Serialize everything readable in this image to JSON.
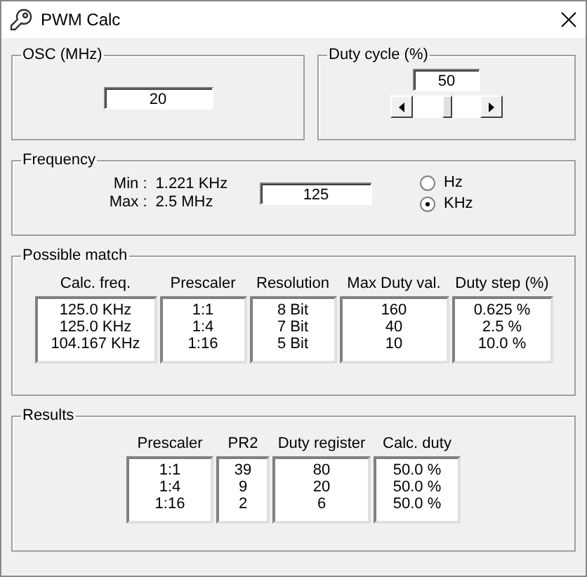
{
  "window": {
    "title": "PWM Calc"
  },
  "osc": {
    "label": "OSC (MHz)",
    "value": "20"
  },
  "duty_cycle": {
    "label": "Duty cycle (%)",
    "value": "50",
    "slider": {
      "level": 0.5
    }
  },
  "frequency": {
    "label": "Frequency",
    "min_label": "Min :",
    "min_value": "1.221 KHz",
    "max_label": "Max :",
    "max_value": "2.5 MHz",
    "value": "125",
    "units": [
      {
        "label": "Hz",
        "selected": false
      },
      {
        "label": "KHz",
        "selected": true
      }
    ]
  },
  "possible_match": {
    "label": "Possible match",
    "columns": [
      {
        "header": "Calc. freq.",
        "cells": [
          "125.0 KHz",
          "125.0 KHz",
          "104.167 KHz"
        ]
      },
      {
        "header": "Prescaler",
        "cells": [
          "1:1",
          "1:4",
          "1:16"
        ]
      },
      {
        "header": "Resolution",
        "cells": [
          "8 Bit",
          "7 Bit",
          "5 Bit"
        ]
      },
      {
        "header": "Max Duty val.",
        "cells": [
          "160",
          "40",
          "10"
        ]
      },
      {
        "header": "Duty step (%)",
        "cells": [
          "0.625 %",
          "2.5 %",
          "10.0 %"
        ]
      }
    ]
  },
  "results": {
    "label": "Results",
    "columns": [
      {
        "header": "Prescaler",
        "cells": [
          "1:1",
          "1:4",
          "1:16"
        ]
      },
      {
        "header": "PR2",
        "cells": [
          "39",
          "9",
          "2"
        ]
      },
      {
        "header": "Duty register",
        "cells": [
          "80",
          "20",
          "6"
        ]
      },
      {
        "header": "Calc. duty",
        "cells": [
          "50.0 %",
          "50.0 %",
          "50.0 %"
        ]
      }
    ]
  }
}
